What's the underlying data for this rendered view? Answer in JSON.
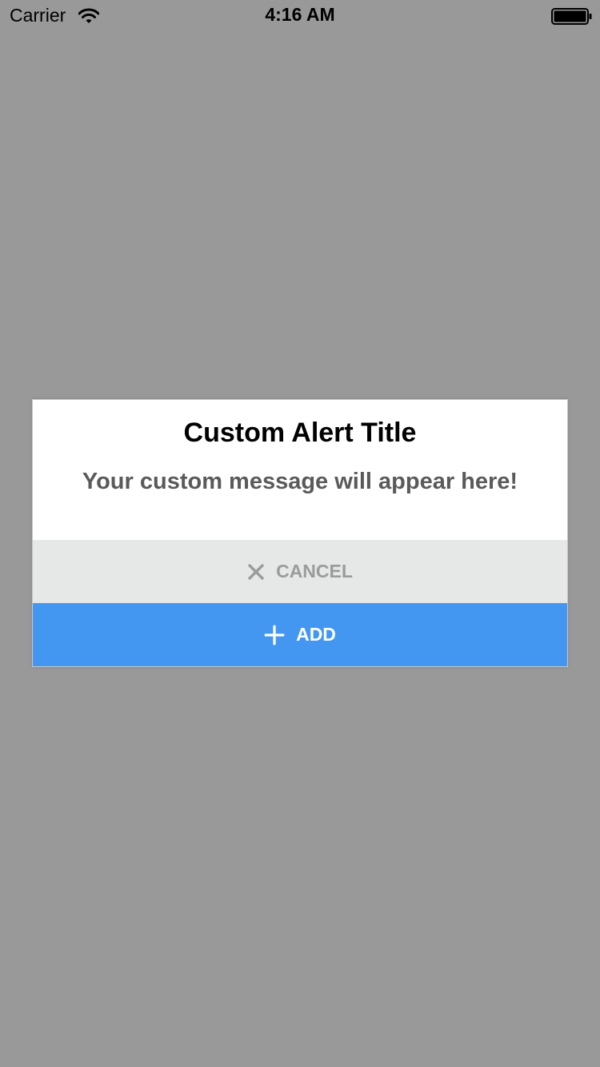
{
  "status_bar": {
    "carrier": "Carrier",
    "time": "4:16 AM",
    "wifi_icon": "wifi-icon",
    "battery_icon": "battery-full-icon"
  },
  "alert": {
    "title": "Custom Alert Title",
    "message": "Your custom message will appear here!",
    "buttons": {
      "cancel": {
        "label": "CANCEL",
        "icon": "close-icon",
        "background": "#e6e7e7",
        "text_color": "#9b9b9b"
      },
      "add": {
        "label": "ADD",
        "icon": "plus-icon",
        "background": "#4397f1",
        "text_color": "#ffffff"
      }
    }
  },
  "colors": {
    "backdrop": "#999999",
    "alert_background": "#ffffff"
  }
}
